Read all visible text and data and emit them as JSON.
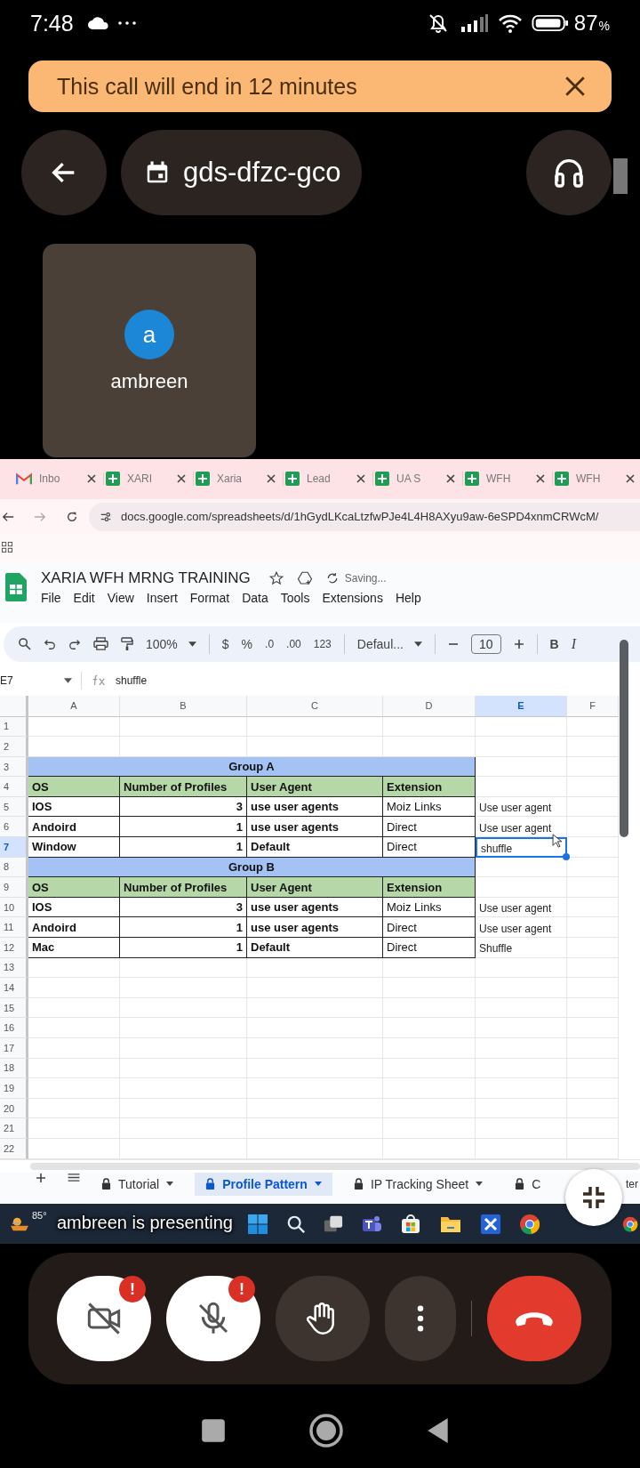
{
  "status_bar": {
    "time": "7:48",
    "battery": "87",
    "percent": "%"
  },
  "banner": {
    "text": "This call will end in 12 minutes"
  },
  "meeting": {
    "code": "gds-dfzc-gco"
  },
  "participant": {
    "initial": "a",
    "name": "ambreen"
  },
  "browser": {
    "tabs": [
      {
        "kind": "gmail",
        "label": "Inbo"
      },
      {
        "kind": "sheets",
        "label": "XARI"
      },
      {
        "kind": "sheets",
        "label": "Xaria"
      },
      {
        "kind": "sheets",
        "label": "Lead"
      },
      {
        "kind": "sheets",
        "label": "UA S"
      },
      {
        "kind": "sheets",
        "label": "WFH"
      },
      {
        "kind": "sheets",
        "label": "WFH"
      }
    ],
    "url": "docs.google.com/spreadsheets/d/1hGydLKcaLtzfwPJe4L4H8AXyu9aw-6eSPD4xnmCRWcM/"
  },
  "sheet": {
    "title": "XARIA WFH MRNG TRAINING",
    "status": "Saving...",
    "menu": [
      "File",
      "Edit",
      "View",
      "Insert",
      "Format",
      "Data",
      "Tools",
      "Extensions",
      "Help"
    ],
    "toolbar": {
      "zoom": "100%",
      "currency": "$",
      "percent": "%",
      "decrease_decimals": ".0",
      "increase_decimals": ".00",
      "number_format": "123",
      "font": "Defaul...",
      "font_size": "10",
      "bold": "B",
      "italic": "I"
    },
    "cell_ref": "E7",
    "formula": "shuffle",
    "columns": [
      {
        "label": "A",
        "selected": false
      },
      {
        "label": "B",
        "selected": false
      },
      {
        "label": "C",
        "selected": false
      },
      {
        "label": "D",
        "selected": false
      },
      {
        "label": "E",
        "selected": true
      },
      {
        "label": "F",
        "selected": false
      }
    ],
    "rows": [
      {
        "number": "1",
        "selected": false,
        "kind": "empty"
      },
      {
        "number": "2",
        "selected": false,
        "kind": "empty"
      },
      {
        "number": "3",
        "selected": false,
        "kind": "group",
        "title": "Group A"
      },
      {
        "number": "4",
        "selected": false,
        "kind": "header",
        "cells": [
          "OS",
          "Number of Profiles",
          "User Agent",
          "Extension"
        ]
      },
      {
        "number": "5",
        "selected": false,
        "kind": "data",
        "cells": [
          "IOS",
          "3",
          "use user agents",
          "Moiz Links"
        ],
        "extra": {
          "text": "Use user agent",
          "selected": false
        }
      },
      {
        "number": "6",
        "selected": false,
        "kind": "data",
        "cells": [
          "Andoird",
          "1",
          "use user agents",
          "Direct"
        ],
        "extra": {
          "text": "Use user agent",
          "selected": false
        }
      },
      {
        "number": "7",
        "selected": true,
        "kind": "data",
        "cells": [
          "Window",
          "1",
          "Default",
          "Direct"
        ],
        "extra": {
          "text": "shuffle",
          "selected": true
        }
      },
      {
        "number": "8",
        "selected": false,
        "kind": "group",
        "title": "Group B"
      },
      {
        "number": "9",
        "selected": false,
        "kind": "header",
        "cells": [
          "OS",
          "Number of Profiles",
          "User Agent",
          "Extension"
        ]
      },
      {
        "number": "10",
        "selected": false,
        "kind": "data",
        "cells": [
          "IOS",
          "3",
          "use user agents",
          "Moiz Links"
        ],
        "extra": {
          "text": "Use user agent",
          "selected": false
        }
      },
      {
        "number": "11",
        "selected": false,
        "kind": "data",
        "cells": [
          "Andoird",
          "1",
          "use user agents",
          "Direct"
        ],
        "extra": {
          "text": "Use user agent",
          "selected": false
        }
      },
      {
        "number": "12",
        "selected": false,
        "kind": "data",
        "cells": [
          "Mac",
          "1",
          "Default",
          "Direct"
        ],
        "extra": {
          "text": "Shuffle",
          "selected": false
        }
      },
      {
        "number": "13",
        "selected": false,
        "kind": "empty"
      },
      {
        "number": "14",
        "selected": false,
        "kind": "empty"
      },
      {
        "number": "15",
        "selected": false,
        "kind": "empty"
      },
      {
        "number": "16",
        "selected": false,
        "kind": "empty"
      },
      {
        "number": "17",
        "selected": false,
        "kind": "empty"
      },
      {
        "number": "18",
        "selected": false,
        "kind": "empty"
      },
      {
        "number": "19",
        "selected": false,
        "kind": "empty"
      },
      {
        "number": "20",
        "selected": false,
        "kind": "empty"
      },
      {
        "number": "21",
        "selected": false,
        "kind": "empty"
      },
      {
        "number": "22",
        "selected": false,
        "kind": "empty"
      }
    ],
    "tabs": [
      {
        "label": "Tutorial",
        "selected": false,
        "locked": true
      },
      {
        "label": "Profile Pattern",
        "selected": true,
        "locked": true
      },
      {
        "label": "IP Tracking Sheet",
        "selected": false,
        "locked": true
      },
      {
        "label": "C",
        "label_end": "ter",
        "selected": false,
        "locked": true
      }
    ]
  },
  "presenter_note": "ambreen is presenting",
  "taskbar": {
    "temperature": "85°"
  },
  "controls": [
    {
      "kind": "camera",
      "on": false,
      "alert": "!"
    },
    {
      "kind": "mic",
      "on": false,
      "alert": "!"
    },
    {
      "kind": "hand"
    },
    {
      "kind": "more"
    },
    {
      "kind": "end"
    }
  ]
}
